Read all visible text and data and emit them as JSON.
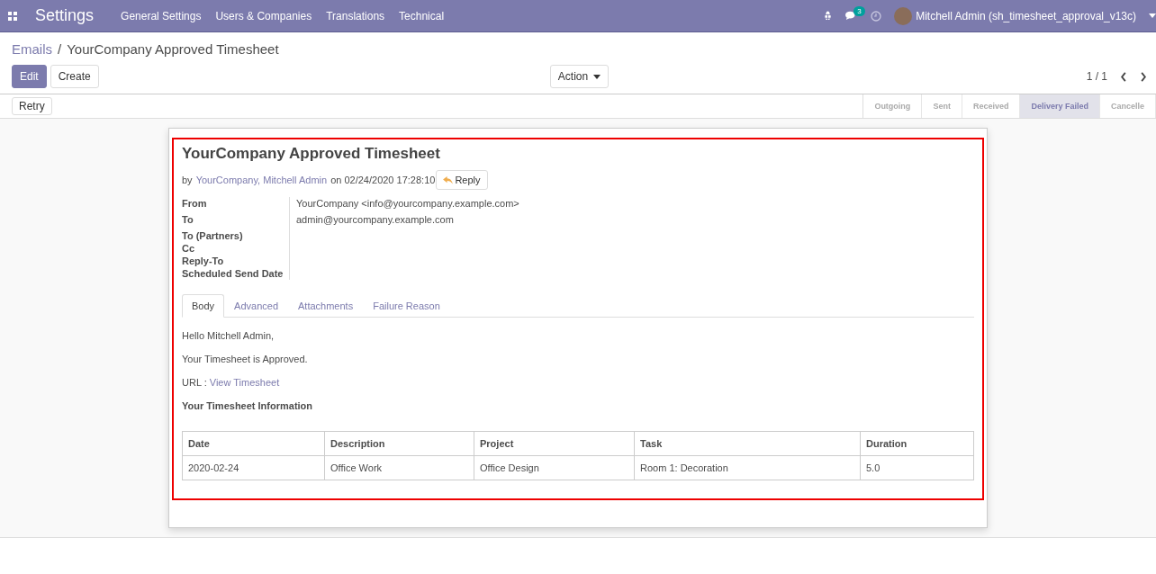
{
  "navbar": {
    "title": "Settings",
    "menu": [
      "General Settings",
      "Users & Companies",
      "Translations",
      "Technical"
    ],
    "message_count": "3",
    "user": "Mitchell Admin (sh_timesheet_approval_v13c)"
  },
  "breadcrumb": {
    "parent": "Emails",
    "separator": "/",
    "current": "YourCompany Approved Timesheet"
  },
  "buttons": {
    "edit": "Edit",
    "create": "Create",
    "action": "Action",
    "retry": "Retry"
  },
  "pager": "1 / 1",
  "stages": [
    {
      "label": "Outgoing",
      "selected": false
    },
    {
      "label": "Sent",
      "selected": false
    },
    {
      "label": "Received",
      "selected": false
    },
    {
      "label": "Delivery Failed",
      "selected": true
    },
    {
      "label": "Cancelle",
      "selected": false
    }
  ],
  "message": {
    "subject": "YourCompany Approved Timesheet",
    "by": "by",
    "authors": "YourCompany, Mitchell Admin",
    "on": "on 02/24/2020 17:28:10",
    "reply": "Reply"
  },
  "fields": [
    {
      "label": "From",
      "value": "YourCompany <info@yourcompany.example.com>"
    },
    {
      "label": "To",
      "value": "admin@yourcompany.example.com"
    },
    {
      "label": "To (Partners)"
    },
    {
      "label": "Cc"
    },
    {
      "label": "Reply-To"
    },
    {
      "label": "Scheduled Send Date"
    }
  ],
  "tabs": [
    {
      "label": "Body",
      "selected": true
    },
    {
      "label": "Advanced",
      "selected": false
    },
    {
      "label": "Attachments",
      "selected": false
    },
    {
      "label": "Failure Reason",
      "selected": false
    }
  ],
  "body": {
    "greeting": "Hello Mitchell Admin,",
    "status": "Your Timesheet is Approved.",
    "url_label": "URL :",
    "url_link": "View Timesheet",
    "heading": "Your Timesheet Information",
    "table": {
      "columns": [
        "Date",
        "Description",
        "Project",
        "Task",
        "Duration"
      ],
      "rows": [
        [
          "2020-02-24",
          "Office Work",
          "Office Design",
          "Room 1: Decoration",
          "5.0"
        ]
      ]
    }
  }
}
